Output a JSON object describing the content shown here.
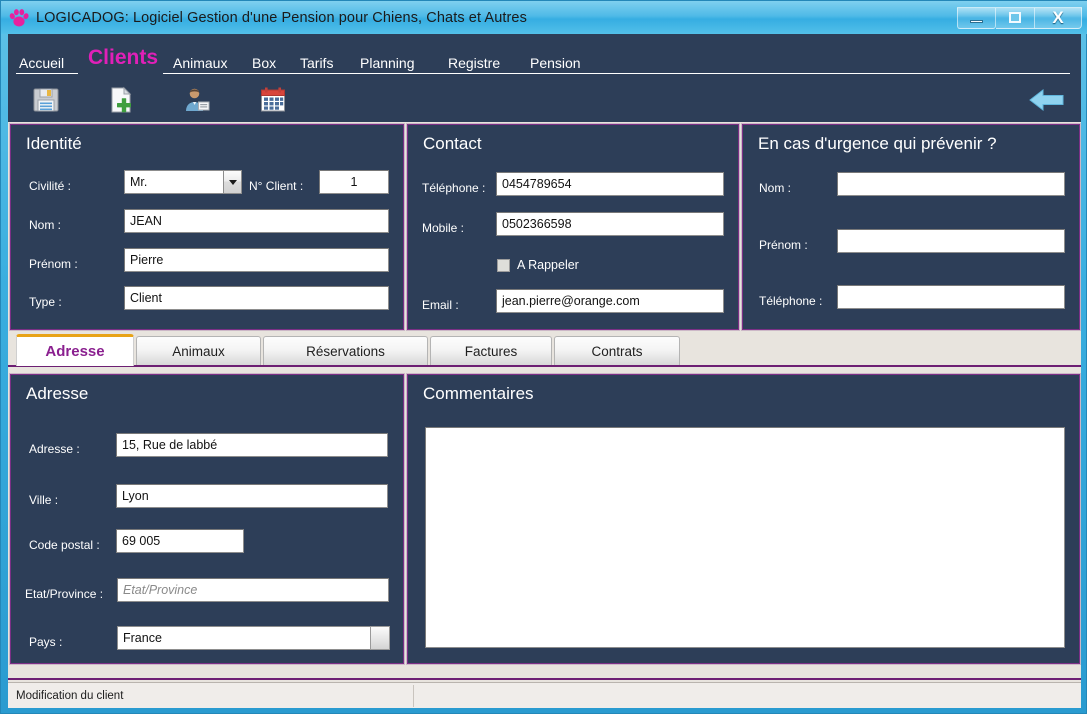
{
  "window": {
    "title": "LOGICADOG: Logiciel Gestion d'une Pension pour Chiens, Chats et  Autres",
    "app_icon": "paw-icon",
    "minimize_label": "Minimize",
    "maximize_label": "Maximize",
    "close_label": "X"
  },
  "nav": {
    "items": [
      {
        "label": "Accueil",
        "active": false
      },
      {
        "label": "Clients",
        "active": true
      },
      {
        "label": "Animaux",
        "active": false
      },
      {
        "label": "Box",
        "active": false
      },
      {
        "label": "Tarifs",
        "active": false
      },
      {
        "label": "Planning",
        "active": false
      },
      {
        "label": "Registre",
        "active": false
      },
      {
        "label": "Pension",
        "active": false
      }
    ],
    "active_color": "#e020b8",
    "bar_color": "#2d3e58"
  },
  "toolbar": {
    "buttons": [
      {
        "icon": "save-floppy-icon",
        "label": "Enregistrer"
      },
      {
        "icon": "new-document-icon",
        "label": "Nouveau"
      },
      {
        "icon": "user-card-icon",
        "label": "Client"
      },
      {
        "icon": "calendar-icon",
        "label": "Planning"
      }
    ],
    "back_button": {
      "icon": "back-arrow-icon",
      "label": "Retour",
      "color": "#8fd3f0"
    }
  },
  "identite": {
    "title": "Identité",
    "civilite_label": "Civilité :",
    "civilite_value": "Mr.",
    "num_client_label": "N° Client :",
    "num_client_value": "1",
    "nom_label": "Nom :",
    "nom_value": "JEAN",
    "prenom_label": "Prénom :",
    "prenom_value": "Pierre",
    "type_label": "Type :",
    "type_value": "Client"
  },
  "contact": {
    "title": "Contact",
    "telephone_label": "Téléphone :",
    "telephone_value": "0454789654",
    "mobile_label": "Mobile :",
    "mobile_value": "0502366598",
    "rappeler_label": "A Rappeler",
    "rappeler_checked": false,
    "email_label": "Email :",
    "email_value": "jean.pierre@orange.com"
  },
  "urgence": {
    "title": "En cas d'urgence qui prévenir ?",
    "nom_label": "Nom :",
    "nom_value": "",
    "prenom_label": "Prénom :",
    "prenom_value": "",
    "telephone_label": "Téléphone :",
    "telephone_value": ""
  },
  "tabs": [
    {
      "label": "Adresse",
      "active": true
    },
    {
      "label": "Animaux",
      "active": false
    },
    {
      "label": "Réservations",
      "active": false
    },
    {
      "label": "Factures",
      "active": false
    },
    {
      "label": "Contrats",
      "active": false
    }
  ],
  "adresse": {
    "title": "Adresse",
    "adresse_label": "Adresse :",
    "adresse_value": "15, Rue de labbé",
    "ville_label": "Ville :",
    "ville_value": "Lyon",
    "code_postal_label": "Code postal :",
    "code_postal_value": "69 005",
    "etat_label": "Etat/Province :",
    "etat_value": "",
    "etat_placeholder": "Etat/Province",
    "pays_label": "Pays :",
    "pays_value": "France"
  },
  "commentaires": {
    "title": "Commentaires",
    "value": ""
  },
  "statusbar": {
    "text": "Modification du client"
  },
  "theme": {
    "panel_bg": "#2d3e58",
    "panel_border": "#7b2f86",
    "accent_purple": "#6d1f73",
    "accent_magenta": "#e020b8",
    "tab_active_top": "#e8a317",
    "window_chrome": "#3aaedf"
  }
}
